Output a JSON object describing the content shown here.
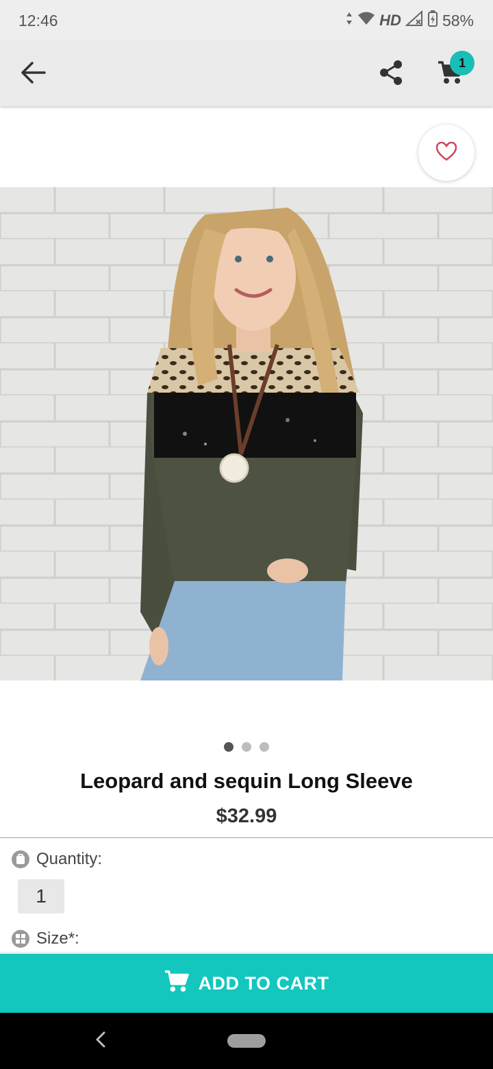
{
  "status_bar": {
    "time": "12:46",
    "network": "HD",
    "battery": "58%"
  },
  "app_bar": {
    "cart_count": "1"
  },
  "product": {
    "title": "Leopard and sequin Long Sleeve",
    "price": "$32.99",
    "image_count": 3,
    "active_image_index": 0
  },
  "options": {
    "quantity_label": "Quantity:",
    "quantity_value": "1",
    "size_label": "Size*:"
  },
  "add_to_cart": {
    "label": "ADD TO CART"
  },
  "colors": {
    "accent": "#13c6be",
    "favorite": "#d0455b"
  },
  "icons": [
    "back-arrow-icon",
    "share-icon",
    "cart-icon",
    "heart-icon",
    "cart-white-icon"
  ]
}
